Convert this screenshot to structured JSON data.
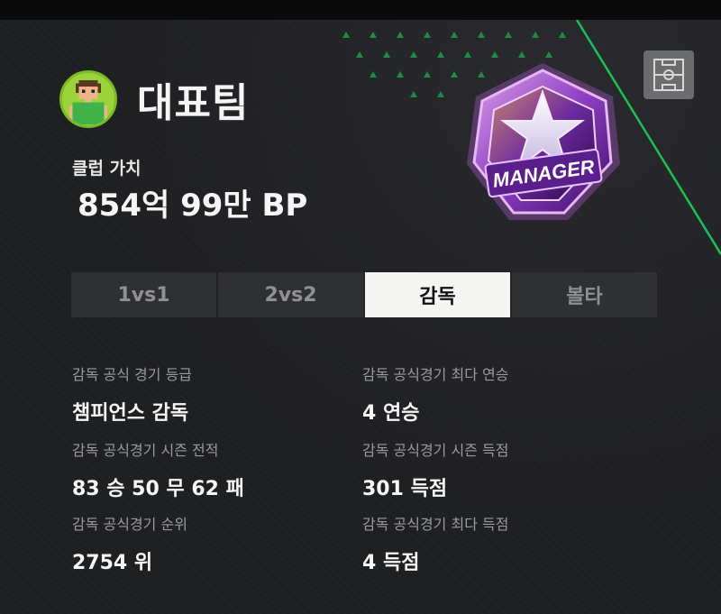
{
  "team": {
    "name": "대표팀",
    "avatar_icon": "player-avatar-icon"
  },
  "club_value": {
    "label": "클럽 가치",
    "value": "854억 99만 BP"
  },
  "badge": {
    "text": "MANAGER",
    "icon": "manager-star-badge"
  },
  "field_button": {
    "icon": "soccer-field-icon"
  },
  "tabs": [
    {
      "label": "1vs1",
      "active": false
    },
    {
      "label": "2vs2",
      "active": false
    },
    {
      "label": "감독",
      "active": true
    },
    {
      "label": "볼타",
      "active": false
    }
  ],
  "stats": {
    "grade": {
      "label": "감독 공식 경기 등급",
      "value": "챔피언스 감독"
    },
    "max_streak": {
      "label": "감독 공식경기 최다 연승",
      "value": "4 연승"
    },
    "season_record": {
      "label": "감독 공식경기 시즌 전적",
      "value": "83 승 50 무 62 패"
    },
    "season_goals": {
      "label": "감독 공식경기 시즌 득점",
      "value": "301 득점"
    },
    "rank": {
      "label": "감독 공식경기 순위",
      "value": "2754 위"
    },
    "max_goals": {
      "label": "감독 공식경기 최다 득점",
      "value": "4 득점"
    }
  },
  "colors": {
    "accent_green": "#22c55e",
    "badge_purple": "#7b2cbf",
    "active_tab_bg": "#f5f5f3"
  }
}
